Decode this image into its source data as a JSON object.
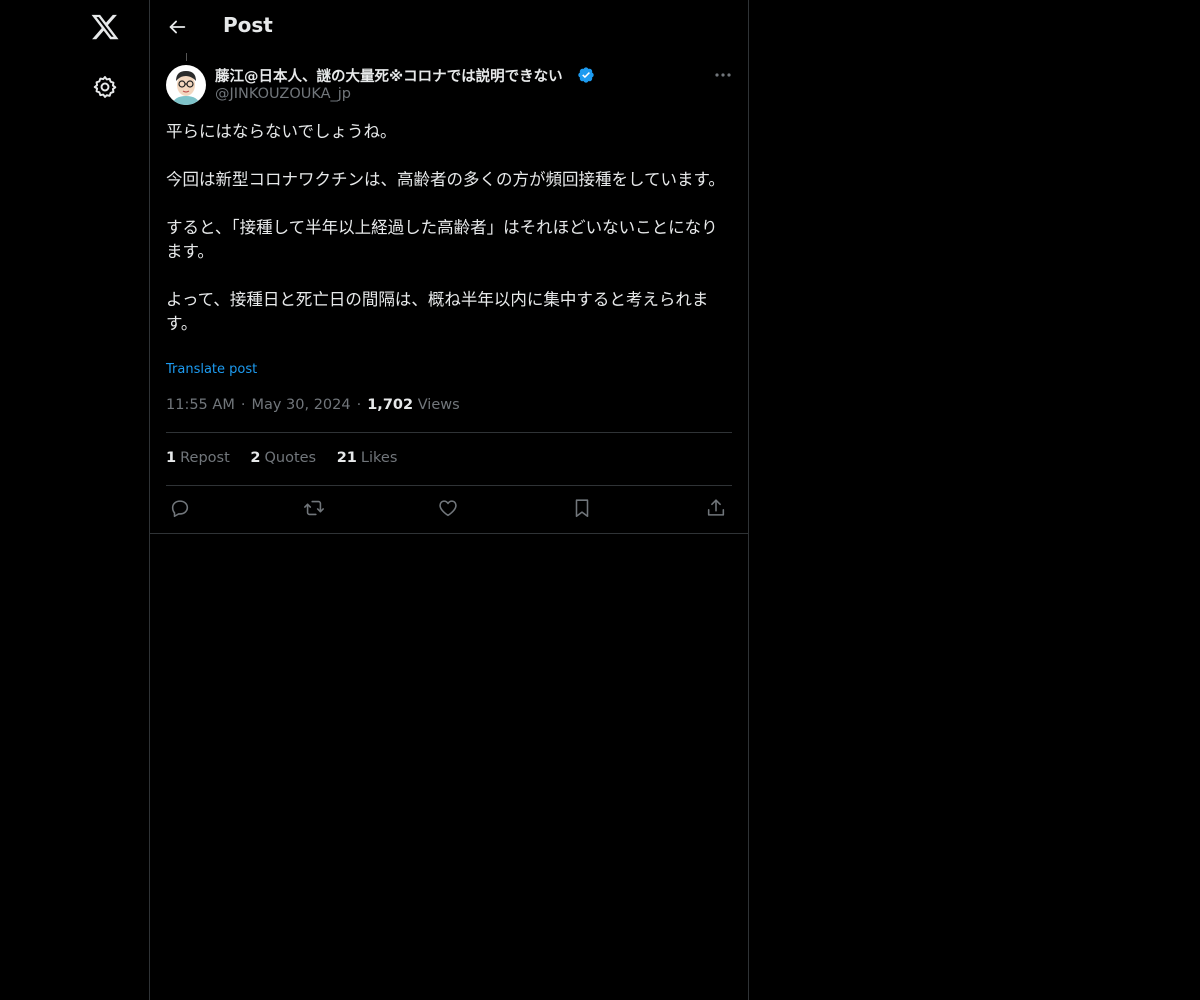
{
  "header": {
    "title": "Post"
  },
  "icons": {
    "logo": "x-logo-icon",
    "settings": "gear-icon",
    "back": "arrow-left-icon",
    "verified": "verified-badge-icon",
    "more": "ellipsis-icon",
    "reply": "reply-icon",
    "repost": "repost-icon",
    "like": "heart-icon",
    "bookmark": "bookmark-icon",
    "share": "share-icon"
  },
  "colors": {
    "background": "#000000",
    "text": "#e7e9ea",
    "secondary": "#71767b",
    "accent": "#1d9bf0",
    "border": "#2f3336"
  },
  "post": {
    "author": {
      "name": "藤江@日本人、謎の大量死※コロナでは説明できない",
      "handle": "@JINKOUZOUKA_jp",
      "verified": true
    },
    "paragraphs": [
      "平らにはならないでしょうね。",
      "今回は新型コロナワクチンは、高齢者の多くの方が頻回接種をしています。",
      "すると、「接種して半年以上経過した高齢者」はそれほどいないことになります。",
      "よって、接種日と死亡日の間隔は、概ね半年以内に集中すると考えられます。"
    ],
    "translate_label": "Translate post",
    "time": "11:55 AM",
    "date": "May 30, 2024",
    "views_count": "1,702",
    "views_label": "Views",
    "separator": "·",
    "stats": {
      "reposts_count": "1",
      "reposts_label": "Repost",
      "quotes_count": "2",
      "quotes_label": "Quotes",
      "likes_count": "21",
      "likes_label": "Likes"
    }
  }
}
